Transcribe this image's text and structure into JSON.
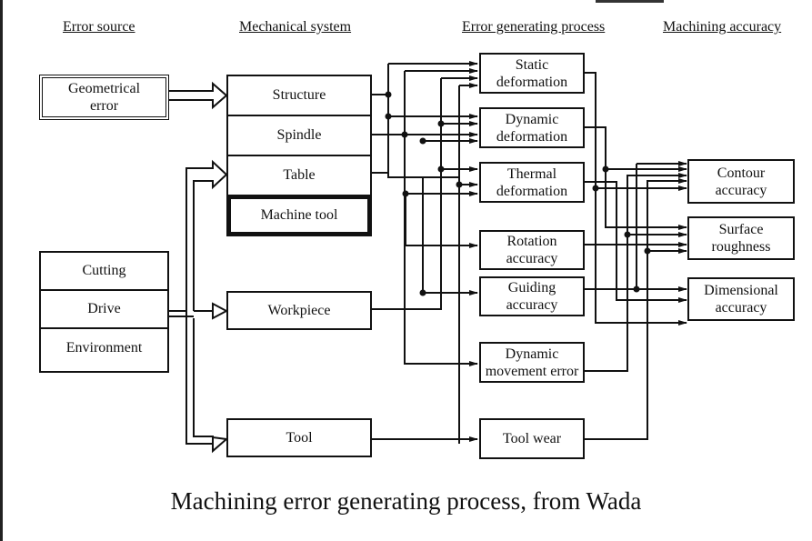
{
  "caption": "Machining error generating process, from Wada",
  "columns": {
    "error_source": "Error source",
    "mechanical_system": "Mechanical system",
    "error_generating_process": "Error generating process",
    "machining_accuracy": "Machining accuracy"
  },
  "error_sources": {
    "geometrical": "Geometrical error",
    "group": [
      "Cutting",
      "Drive",
      "Environment"
    ]
  },
  "mechanical_system": {
    "machine_tool_parts": [
      "Structure",
      "Spindle",
      "Table",
      "Machine tool"
    ],
    "workpiece": "Workpiece",
    "tool": "Tool"
  },
  "processes": [
    {
      "line1": "Static",
      "line2": "deformation"
    },
    {
      "line1": "Dynamic",
      "line2": "deformation"
    },
    {
      "line1": "Thermal",
      "line2": "deformation"
    },
    {
      "line1": "Rotation",
      "line2": "accuracy"
    },
    {
      "line1": "Guiding",
      "line2": "accuracy"
    },
    {
      "line1": "Dynamic",
      "line2": "movement error"
    },
    {
      "line1": "Tool wear",
      "line2": ""
    }
  ],
  "accuracy": [
    {
      "line1": "Contour",
      "line2": "accuracy"
    },
    {
      "line1": "Surface",
      "line2": "roughness"
    },
    {
      "line1": "Dimensional",
      "line2": "accuracy"
    }
  ]
}
